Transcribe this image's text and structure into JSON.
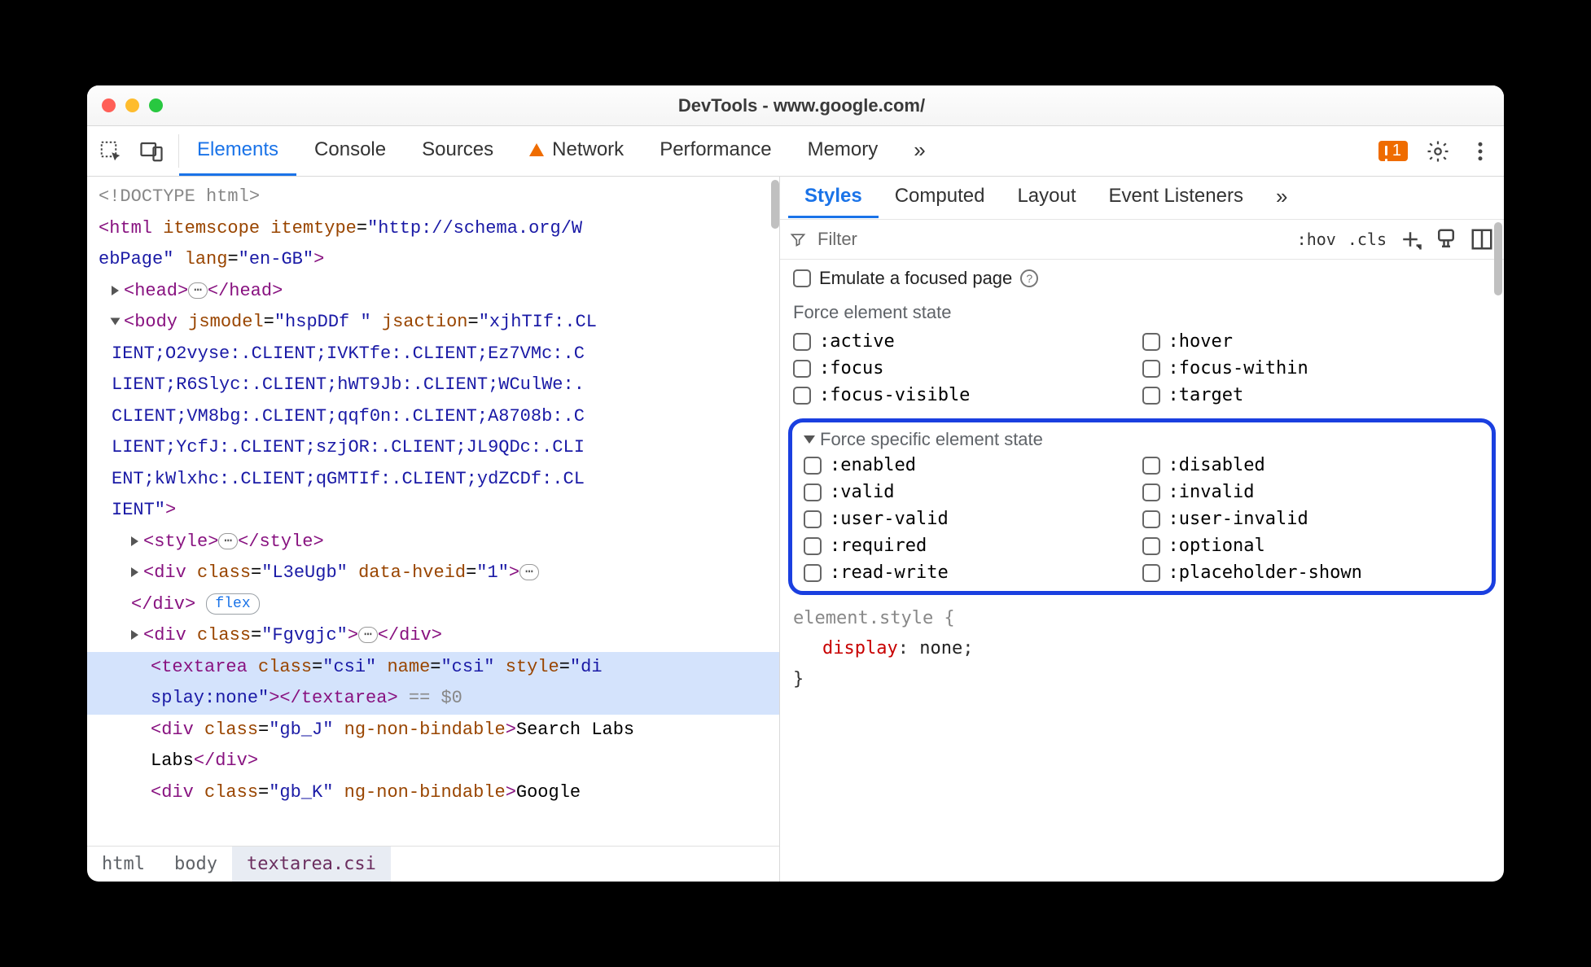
{
  "window": {
    "title": "DevTools - www.google.com/"
  },
  "toolbar": {
    "tabs": [
      "Elements",
      "Console",
      "Sources",
      "Network",
      "Performance",
      "Memory"
    ],
    "active_tab": "Elements",
    "warn_tab": "Network",
    "more": "»",
    "issue_count": "1"
  },
  "dom": {
    "doctype": "<!DOCTYPE html>",
    "html_open_1": "<html itemscope itemtype=\"http://schema.org/W",
    "html_open_2": "ebPage\" lang=\"en-GB\">",
    "head": {
      "open": "<head>",
      "close": "</head>"
    },
    "body_open_1": "<body jsmodel=\"hspDDf \" jsaction=\"xjhTIf:.CL",
    "body_open_2": "IENT;O2vyse:.CLIENT;IVKTfe:.CLIENT;Ez7VMc:.C",
    "body_open_3": "LIENT;R6Slyc:.CLIENT;hWT9Jb:.CLIENT;WCulWe:.",
    "body_open_4": "CLIENT;VM8bg:.CLIENT;qqf0n:.CLIENT;A8708b:.C",
    "body_open_5": "LIENT;YcfJ:.CLIENT;szjOR:.CLIENT;JL9QDc:.CLI",
    "body_open_6": "ENT;kWlxhc:.CLIENT;qGMTIf:.CLIENT;ydZCDf:.CL",
    "body_open_7": "IENT\">",
    "style": {
      "open": "<style>",
      "close": "</style>"
    },
    "div1": {
      "text": "<div class=\"L3eUgb\" data-hveid=\"1\">",
      "close": "</div>",
      "badge": "flex"
    },
    "div2": {
      "text": "<div class=\"Fgvgjc\">",
      "close": "</div>"
    },
    "textarea_1": "<textarea class=\"csi\" name=\"csi\" style=\"di",
    "textarea_2a": "splay:none\">",
    "textarea_2b": "</textarea>",
    "textarea_eq": "== $0",
    "div3_a": "<div class=\"gb_J\" ng-non-bindable>",
    "div3_text": "Search Labs",
    "div3_b": "</div>",
    "div4_a": "<div class=\"gb_K\" ng-non-bindable>",
    "div4_text": "Google"
  },
  "breadcrumb": {
    "items": [
      "html",
      "body",
      "textarea.csi"
    ],
    "selected": "textarea.csi"
  },
  "right_tabs": {
    "items": [
      "Styles",
      "Computed",
      "Layout",
      "Event Listeners"
    ],
    "active": "Styles",
    "more": "»"
  },
  "filter": {
    "placeholder": "Filter",
    "hov": ":hov",
    "cls": ".cls"
  },
  "emulate": {
    "label": "Emulate a focused page"
  },
  "force_state": {
    "title": "Force element state",
    "items": [
      ":active",
      ":hover",
      ":focus",
      ":focus-within",
      ":focus-visible",
      ":target"
    ]
  },
  "force_specific": {
    "title": "Force specific element state",
    "items": [
      ":enabled",
      ":disabled",
      ":valid",
      ":invalid",
      ":user-valid",
      ":user-invalid",
      ":required",
      ":optional",
      ":read-write",
      ":placeholder-shown"
    ]
  },
  "style_rule": {
    "selector": "element.style {",
    "prop": "display",
    "val": "none",
    "close": "}"
  }
}
